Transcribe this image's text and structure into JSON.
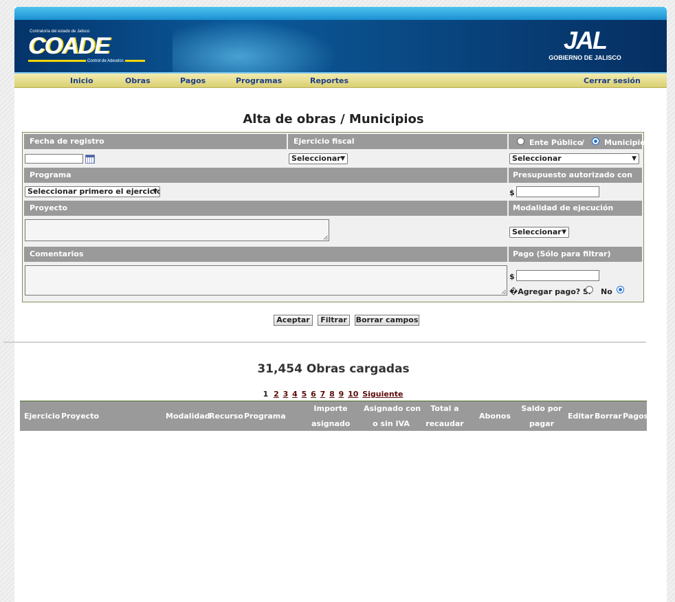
{
  "header": {
    "coade_small": "Contraloría del estado de Jalisco",
    "coade_logo": "COADE",
    "coade_sub": "Control de Adeudos",
    "jal_logo": "JAL",
    "jal_sub": "GOBIERNO DE JALISCO"
  },
  "nav": {
    "items": [
      "Inicio",
      "Obras",
      "Pagos",
      "Programas",
      "Reportes"
    ],
    "logout": "Cerrar sesión"
  },
  "page_title": "Alta de obras / Municipios",
  "form": {
    "fecha_registro": {
      "label": "Fecha de registro",
      "value": ""
    },
    "ejercicio": {
      "label": "Ejercicio fiscal",
      "selected": "Seleccionar"
    },
    "ente_publico": {
      "label": "Ente Público",
      "checked": false
    },
    "separator": "/",
    "municipio": {
      "label": "Municipio",
      "checked": true
    },
    "municipio_select": "Seleccionar",
    "programa": {
      "label": "Programa",
      "selected": "Seleccionar primero el ejercicio"
    },
    "presupuesto": {
      "label": "Presupuesto autorizado con I.V.A.",
      "currency": "$",
      "value": ""
    },
    "proyecto": {
      "label": "Proyecto",
      "value": ""
    },
    "modalidad": {
      "label": "Modalidad de ejecución",
      "selected": "Seleccionar"
    },
    "comentarios": {
      "label": "Comentarios",
      "value": ""
    },
    "pago": {
      "label": "Pago (Sólo para filtrar)",
      "currency": "$",
      "value": ""
    },
    "agregar_pago": {
      "label": "�Agregar pago? Sí",
      "no_label": "No",
      "si_checked": false,
      "no_checked": true
    }
  },
  "buttons": {
    "aceptar": "Aceptar",
    "filtrar": "Filtrar",
    "borrar": "Borrar campos"
  },
  "results": {
    "count_title": "31,454 Obras cargadas",
    "pages": [
      "1",
      "2",
      "3",
      "4",
      "5",
      "6",
      "7",
      "8",
      "9",
      "10"
    ],
    "current_page": "1",
    "next": "Siguiente",
    "columns": {
      "ejercicio": "Ejercicio",
      "proyecto": "Proyecto",
      "modalidad": "Modalidad",
      "recurso": "Recurso",
      "programa": "Programa",
      "importe_1": "Importe",
      "importe_2": "asignado",
      "asignado_1": "Asignado con",
      "asignado_2": "o sin IVA",
      "total_1": "Total a",
      "total_2": "recaudar",
      "abonos": "Abonos",
      "saldo_1": "Saldo por",
      "saldo_2": "pagar",
      "editar": "Editar",
      "borrar": "Borrar",
      "pagos": "Pagos"
    }
  }
}
